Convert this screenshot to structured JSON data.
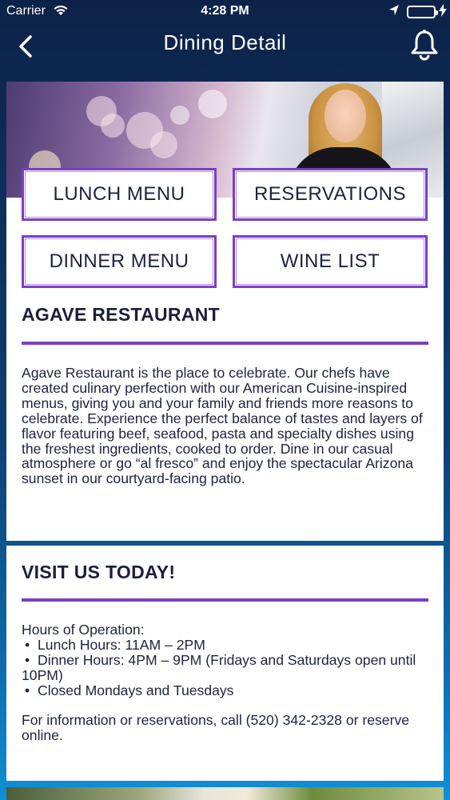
{
  "status_bar": {
    "carrier": "Carrier",
    "time": "4:28 PM",
    "battery_color": "#3ddc5a"
  },
  "nav": {
    "title": "Dining Detail",
    "back_icon": "chevron-left-icon",
    "bell_icon": "bell-icon"
  },
  "buttons": {
    "lunch_menu": "LUNCH MENU",
    "reservations": "RESERVATIONS",
    "dinner_menu": "DINNER MENU",
    "wine_list": "WINE LIST"
  },
  "restaurant": {
    "name": "AGAVE RESTAURANT",
    "description": "Agave Restaurant is the place to celebrate. Our chefs have created culinary perfection with our American Cuisine-inspired menus, giving you and your family and friends more reasons to celebrate. Experience the perfect balance of tastes and layers of flavor featuring beef, seafood, pasta and specialty dishes using the freshest ingredients, cooked to order. Dine in our casual atmosphere or go “al fresco” and enjoy the spectacular Arizona sunset in our courtyard-facing patio."
  },
  "visit": {
    "title": "VISIT US TODAY!",
    "hours_heading": "Hours of Operation:",
    "hours": [
      "Lunch Hours: 11AM – 2PM",
      "Dinner Hours: 4PM – 9PM (Fridays and Saturdays open until 10PM)",
      "Closed Mondays and Tuesdays"
    ],
    "contact": "For information or reservations, call (520) 342-2328 or reserve online."
  },
  "colors": {
    "accent": "#7b3fc4",
    "nav_background": "#0d2248",
    "text": "#1a1f3a"
  }
}
